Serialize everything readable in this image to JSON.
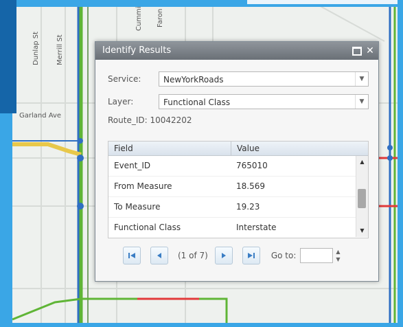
{
  "dialog": {
    "title": "Identify Results",
    "service_label": "Service:",
    "service_value": "NewYorkRoads",
    "layer_label": "Layer:",
    "layer_value": "Functional Class",
    "route_label": "Route_ID:",
    "route_value": "10042202"
  },
  "table": {
    "columns": [
      "Field",
      "Value"
    ],
    "rows": [
      {
        "field": "Event_ID",
        "value": "765010"
      },
      {
        "field": "From Measure",
        "value": "18.569"
      },
      {
        "field": "To Measure",
        "value": "19.23"
      },
      {
        "field": "Functional Class",
        "value": "Interstate"
      }
    ]
  },
  "pager": {
    "page_text": "(1 of 7)",
    "goto_label": "Go to:",
    "goto_value": ""
  },
  "map": {
    "labels": [
      "Garland Ave",
      "Dunlap St",
      "Merrill St",
      "Faron Lu",
      "Cummings Rd"
    ]
  },
  "colors": {
    "frame": "#3aa6e6",
    "road_green": "#5fb536",
    "road_blue": "#2f6fc2",
    "road_red": "#e23a3a",
    "road_yellow": "#e8c84a"
  }
}
